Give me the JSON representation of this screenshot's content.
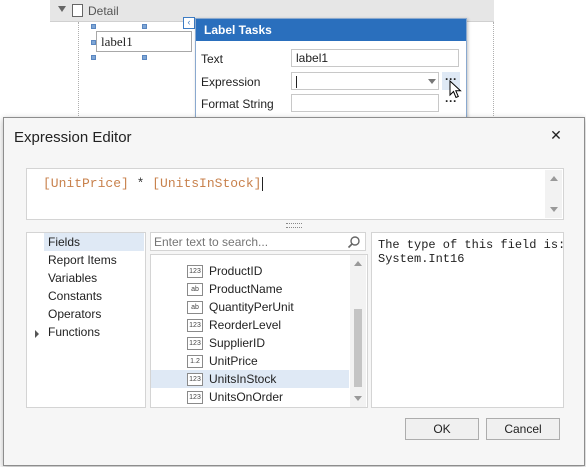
{
  "designer": {
    "band_label": "Detail",
    "label_control_text": "label1",
    "smart_tag_glyph": "‹"
  },
  "label_tasks": {
    "title": "Label Tasks",
    "rows": [
      {
        "label": "Text",
        "value": "label1"
      },
      {
        "label": "Expression",
        "value": ""
      },
      {
        "label": "Format String",
        "value": ""
      }
    ],
    "ellipsis": "···"
  },
  "expression_editor": {
    "title": "Expression Editor",
    "close_glyph": "✕",
    "expression": {
      "part1": "[UnitPrice]",
      "op": " * ",
      "part2": "[UnitsInStock]"
    },
    "categories": [
      {
        "label": "Fields",
        "selected": true
      },
      {
        "label": "Report Items",
        "selected": false
      },
      {
        "label": "Variables",
        "selected": false
      },
      {
        "label": "Constants",
        "selected": false
      },
      {
        "label": "Operators",
        "selected": false
      },
      {
        "label": "Functions",
        "selected": false
      }
    ],
    "search_placeholder": "Enter text to search...",
    "fields": [
      {
        "name": "ProductID",
        "type_icon": "123",
        "selected": false
      },
      {
        "name": "ProductName",
        "type_icon": "ab",
        "selected": false
      },
      {
        "name": "QuantityPerUnit",
        "type_icon": "ab",
        "selected": false
      },
      {
        "name": "ReorderLevel",
        "type_icon": "123",
        "selected": false
      },
      {
        "name": "SupplierID",
        "type_icon": "123",
        "selected": false
      },
      {
        "name": "UnitPrice",
        "type_icon": "1.2",
        "selected": false
      },
      {
        "name": "UnitsInStock",
        "type_icon": "123",
        "selected": true
      },
      {
        "name": "UnitsOnOrder",
        "type_icon": "123",
        "selected": false
      }
    ],
    "description": "The type of this field is:\nSystem.Int16",
    "ok_label": "OK",
    "cancel_label": "Cancel"
  },
  "colors": {
    "accent": "#2a6fbd",
    "selection": "#dfe9f5",
    "field_token": "#c8814c"
  }
}
